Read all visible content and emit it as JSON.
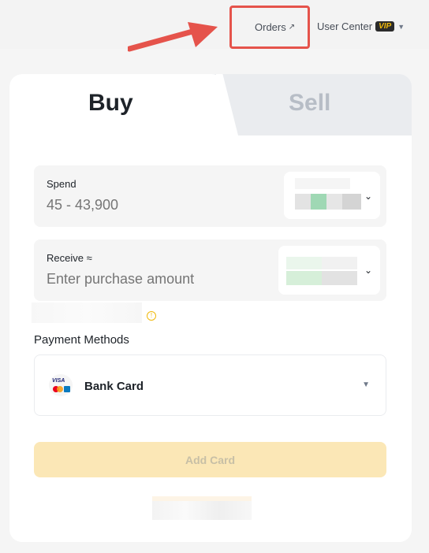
{
  "header": {
    "orders_label": "Orders",
    "orders_icon": "external-link-icon",
    "user_center_label": "User Center",
    "vip_badge": "VIP",
    "user_caret_icon": "caret-down-icon",
    "annotation_arrow_color": "#e5534b"
  },
  "tabs": [
    {
      "label": "Buy",
      "active": true
    },
    {
      "label": "Sell",
      "active": false
    }
  ],
  "spend": {
    "label": "Spend",
    "placeholder": "45 - 43,900"
  },
  "receive": {
    "label": "Receive ≈",
    "placeholder": "Enter purchase amount"
  },
  "payment": {
    "title": "Payment Methods",
    "selected": "Bank Card",
    "icon": "card-brands-icon"
  },
  "add_card_label": "Add Card",
  "colors": {
    "accent": "#f0b90b",
    "button_disabled_bg": "#fbe7b6",
    "text_primary": "#1e2329",
    "text_muted": "#b7bdc6"
  }
}
